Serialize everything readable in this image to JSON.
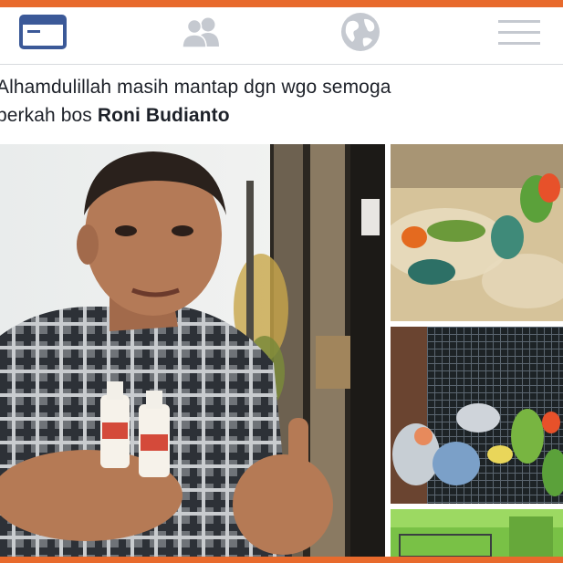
{
  "nav": {
    "items": [
      {
        "name": "news-feed-icon",
        "active": true
      },
      {
        "name": "friends-icon",
        "active": false
      },
      {
        "name": "notifications-globe-icon",
        "active": false
      },
      {
        "name": "menu-icon",
        "active": false
      }
    ],
    "active_color": "#3b5998",
    "inactive_color": "#c5c9d0"
  },
  "post": {
    "text_line1": "Alhamdulillah masih mantap dgn wgo semoga",
    "text_line2_prefix": "berkah bos ",
    "mention": "Roni Budianto"
  },
  "photos": [
    {
      "name": "main-photo",
      "subject": "man-holding-bottles"
    },
    {
      "name": "thumb-photo-1",
      "subject": "lovebirds-in-box"
    },
    {
      "name": "thumb-photo-2",
      "subject": "lovebirds-in-cage"
    },
    {
      "name": "thumb-photo-3",
      "subject": "cage-green-wall"
    }
  ],
  "colors": {
    "frame": "#e86a2c",
    "text": "#1d2129"
  }
}
